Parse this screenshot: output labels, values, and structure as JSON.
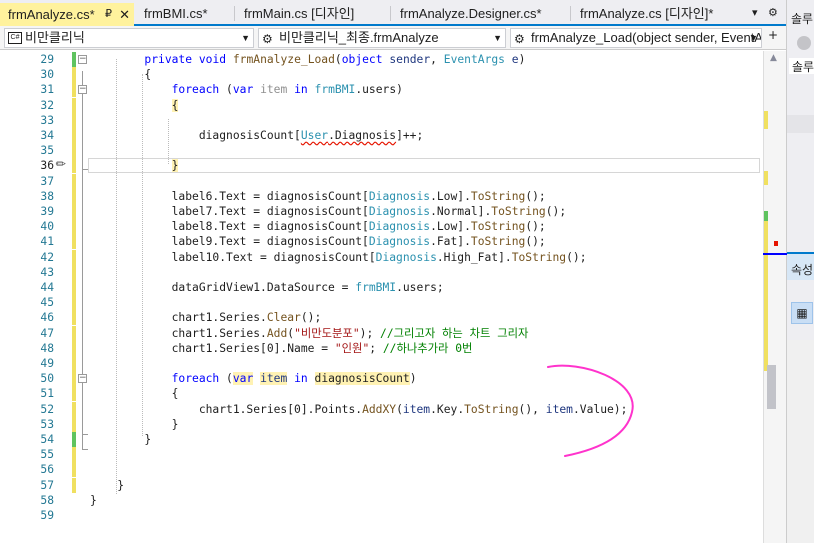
{
  "tabs": [
    {
      "label": "frmAnalyze.cs*",
      "active": true,
      "pin_icon": "pin-icon",
      "close_icon": "close-icon"
    },
    {
      "label": "frmBMI.cs*",
      "active": false
    },
    {
      "label": "frmMain.cs [디자인]",
      "active": false
    },
    {
      "label": "frmAnalyze.Designer.cs*",
      "active": false
    },
    {
      "label": "frmAnalyze.cs [디자인]*",
      "active": false
    }
  ],
  "tab_tools": {
    "dropdown": "▾",
    "settings": "⚙"
  },
  "navbar": {
    "project": "비만클리닉",
    "class": "비만클리닉_최종.frmAnalyze",
    "member": "frmAnalyze_Load(object sender, EventAr"
  },
  "solution_panel": {
    "title": "솔루",
    "search": "솔루"
  },
  "properties_panel": {
    "title": "속성"
  },
  "editor": {
    "lines": [
      {
        "n": "29",
        "html": "        <span class=\"kw\">private</span> <span class=\"kw\">void</span> <span class=\"mt\">frmAnalyze_Load</span>(<span class=\"kw\">object</span> <span class=\"vr\">sender</span>, <span class=\"ty\">EventArgs</span> <span class=\"vr\">e</span>)"
      },
      {
        "n": "30",
        "html": "        {"
      },
      {
        "n": "31",
        "html": "            <span class=\"kw\">foreach</span> (<span class=\"kw\">var</span> <span class=\"dim\">item</span> <span class=\"kw\">in</span> <span class=\"ty\">frmBMI</span>.users)"
      },
      {
        "n": "32",
        "html": "            <span class=\"hlw\">{</span>"
      },
      {
        "n": "33",
        "html": ""
      },
      {
        "n": "34",
        "html": "                diagnosisCount[<span class=\"ty squig\">User</span><span class=\"squig\">.Diagnosis</span>]++;"
      },
      {
        "n": "35",
        "html": ""
      },
      {
        "n": "36",
        "html": "            <span class=\"hlw\">}</span>"
      },
      {
        "n": "37",
        "html": ""
      },
      {
        "n": "38",
        "html": "            label6.Text = diagnosisCount[<span class=\"ty\">Diagnosis</span>.Low].<span class=\"mt\">ToString</span>();"
      },
      {
        "n": "39",
        "html": "            label7.Text = diagnosisCount[<span class=\"ty\">Diagnosis</span>.Normal].<span class=\"mt\">ToString</span>();"
      },
      {
        "n": "40",
        "html": "            label8.Text = diagnosisCount[<span class=\"ty\">Diagnosis</span>.Low].<span class=\"mt\">ToString</span>();"
      },
      {
        "n": "41",
        "html": "            label9.Text = diagnosisCount[<span class=\"ty\">Diagnosis</span>.Fat].<span class=\"mt\">ToString</span>();"
      },
      {
        "n": "42",
        "html": "            label10.Text = diagnosisCount[<span class=\"ty\">Diagnosis</span>.High_Fat].<span class=\"mt\">ToString</span>();"
      },
      {
        "n": "43",
        "html": ""
      },
      {
        "n": "44",
        "html": "            dataGridView1.DataSource = <span class=\"ty\">frmBMI</span>.users;"
      },
      {
        "n": "45",
        "html": ""
      },
      {
        "n": "46",
        "html": "            chart1.Series.<span class=\"mt\">Clear</span>();"
      },
      {
        "n": "47",
        "html": "            chart1.Series.<span class=\"mt\">Add</span>(<span class=\"st\">\"비만도분포\"</span>); <span class=\"cm\">//그리고자 하는 차트 그리자</span>"
      },
      {
        "n": "48",
        "html": "            chart1.Series[0].Name = <span class=\"st\">\"인원\"</span>; <span class=\"cm\">//하나추가라 0번</span>"
      },
      {
        "n": "49",
        "html": ""
      },
      {
        "n": "50",
        "html": "            <span class=\"kw\">foreach</span> (<span class=\"kw hlw\">var</span> <span class=\"vr hlw\">item</span> <span class=\"kw\">in</span> <span class=\"hlw\">diagnosisCount</span>)"
      },
      {
        "n": "51",
        "html": "            {"
      },
      {
        "n": "52",
        "html": "                chart1.Series[0].Points.<span class=\"mt\">AddXY</span>(<span class=\"vr\">item</span>.Key.<span class=\"mt\">ToString</span>(), <span class=\"vr\">item</span>.Value);"
      },
      {
        "n": "53",
        "html": "            }"
      },
      {
        "n": "54",
        "html": "        }"
      },
      {
        "n": "55",
        "html": ""
      },
      {
        "n": "56",
        "html": ""
      },
      {
        "n": "57",
        "html": "    }"
      },
      {
        "n": "58",
        "html": "}"
      },
      {
        "n": "59",
        "html": ""
      }
    ]
  },
  "colors": {
    "accent": "#007acc",
    "active_tab": "#fff29d",
    "annotation": "#ff33cc"
  }
}
